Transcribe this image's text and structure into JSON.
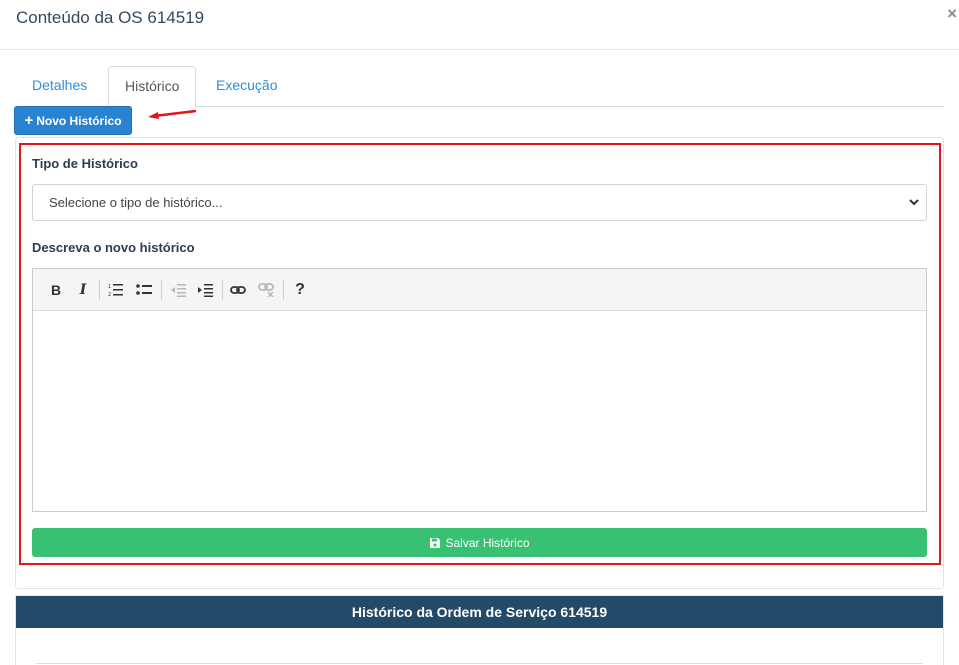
{
  "modal": {
    "title": "Conteúdo da OS 614519",
    "close_label": "×"
  },
  "tabs": [
    {
      "label": "Detalhes",
      "active": false
    },
    {
      "label": "Histórico",
      "active": true
    },
    {
      "label": "Execução",
      "active": false
    }
  ],
  "new_history_button": {
    "icon": "plus-icon",
    "label": "Novo Histórico"
  },
  "form": {
    "type_label": "Tipo de Histórico",
    "type_select_value": "Selecione o tipo de histórico...",
    "description_label": "Descreva o novo histórico",
    "editor": {
      "toolbar": {
        "bold": "B",
        "italic": "I",
        "help": "?"
      },
      "content": ""
    },
    "save_button": {
      "icon": "save-icon",
      "label": "Salvar Histórico"
    }
  },
  "history_panel": {
    "title": "Histórico da Ordem de Serviço 614519"
  },
  "colors": {
    "primary": "#2a83d0",
    "success": "#38c172",
    "highlight": "#e0161b",
    "panel_header": "#234a69",
    "tab_link": "#2f8fd8"
  }
}
